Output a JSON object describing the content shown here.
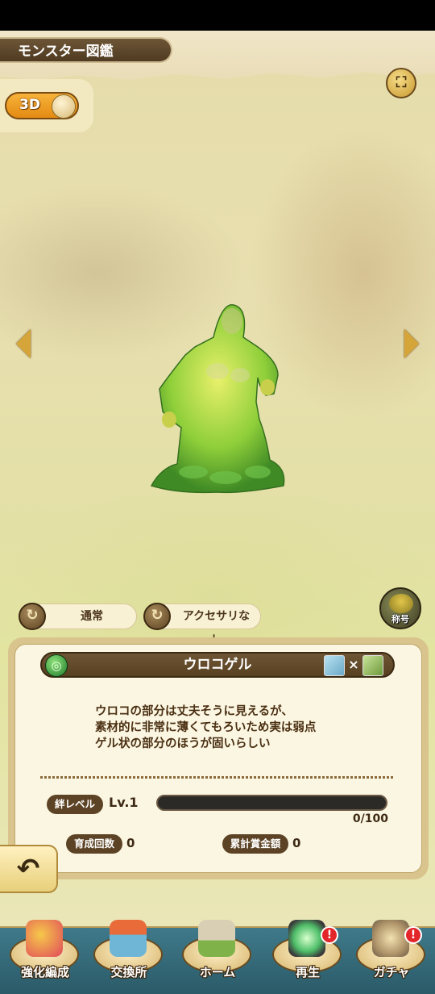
{
  "header": {
    "title": "モンスター図鑑",
    "expand_icon": "expand-icon"
  },
  "view_toggle": {
    "label": "3D"
  },
  "filters": {
    "form_label": "通常",
    "accessory_label": "アクセサリなし"
  },
  "title_badge": {
    "label": "称号"
  },
  "monster": {
    "name": "ウロコゲル",
    "element_icon": "wind-element-icon",
    "combine_symbol": "×",
    "description": [
      "ウロコの部分は丈夫そうに見えるが、",
      "素材的に非常に薄くてもろいため実は弱点",
      "ゲル状の部分のほうが固いらしい"
    ]
  },
  "bond": {
    "label": "絆レベル",
    "level": "Lv.1",
    "progress_text": "0/100",
    "progress": 0.0
  },
  "stats": {
    "raise_count_label": "育成回数",
    "raise_count": "0",
    "prize_label": "累計賞金額",
    "prize": "0"
  },
  "nav": {
    "items": [
      {
        "label": "強化編成",
        "alert": false
      },
      {
        "label": "交換所",
        "alert": false
      },
      {
        "label": "ホーム",
        "alert": false
      },
      {
        "label": "再生",
        "alert": true
      },
      {
        "label": "ガチャ",
        "alert": true
      }
    ],
    "alert_text": "!"
  },
  "colors": {
    "accent": "#e48a12",
    "panel": "#fbf6e2",
    "nav_bg": "#2b5a68",
    "alert": "#e2262a"
  }
}
